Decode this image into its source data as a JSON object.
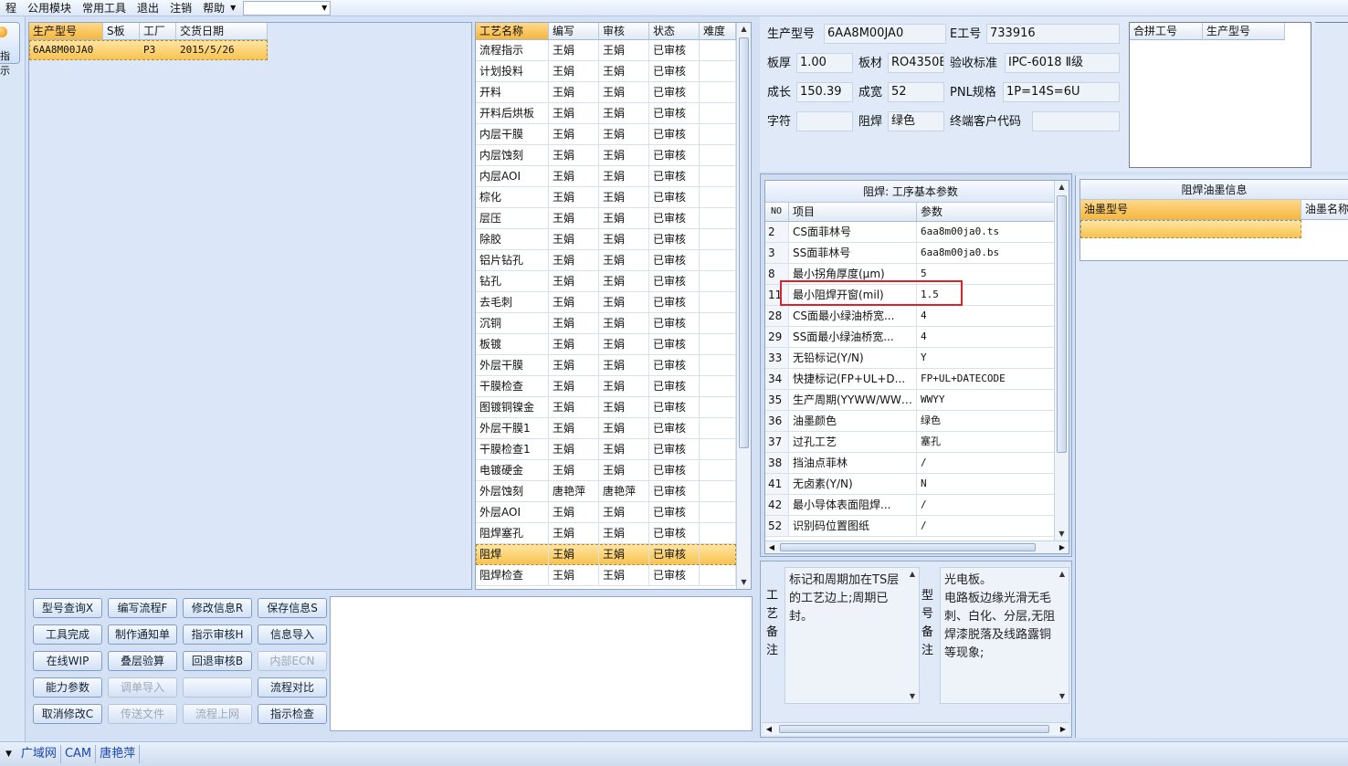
{
  "menu": {
    "items": [
      "程",
      "公用模块",
      "常用工具",
      "退出",
      "注销",
      "帮助"
    ]
  },
  "left_strip": {
    "label": "指示"
  },
  "orders": {
    "columns": [
      "生产型号",
      "S板",
      "工厂",
      "交货日期"
    ],
    "rows": [
      {
        "model": "6AA8M00JA0",
        "s": "",
        "factory": "P3",
        "date": "2015/5/26"
      }
    ]
  },
  "processes": {
    "columns": [
      "工艺名称",
      "编写",
      "审核",
      "状态",
      "难度"
    ],
    "rows": [
      [
        "流程指示",
        "王娟",
        "王娟",
        "已审核",
        ""
      ],
      [
        "计划投料",
        "王娟",
        "王娟",
        "已审核",
        ""
      ],
      [
        "开料",
        "王娟",
        "王娟",
        "已审核",
        ""
      ],
      [
        "开料后烘板",
        "王娟",
        "王娟",
        "已审核",
        ""
      ],
      [
        "内层干膜",
        "王娟",
        "王娟",
        "已审核",
        ""
      ],
      [
        "内层蚀刻",
        "王娟",
        "王娟",
        "已审核",
        ""
      ],
      [
        "内层AOI",
        "王娟",
        "王娟",
        "已审核",
        ""
      ],
      [
        "棕化",
        "王娟",
        "王娟",
        "已审核",
        ""
      ],
      [
        "层压",
        "王娟",
        "王娟",
        "已审核",
        ""
      ],
      [
        "除胶",
        "王娟",
        "王娟",
        "已审核",
        ""
      ],
      [
        "铝片钻孔",
        "王娟",
        "王娟",
        "已审核",
        ""
      ],
      [
        "钻孔",
        "王娟",
        "王娟",
        "已审核",
        ""
      ],
      [
        "去毛刺",
        "王娟",
        "王娟",
        "已审核",
        ""
      ],
      [
        "沉铜",
        "王娟",
        "王娟",
        "已审核",
        ""
      ],
      [
        "板镀",
        "王娟",
        "王娟",
        "已审核",
        ""
      ],
      [
        "外层干膜",
        "王娟",
        "王娟",
        "已审核",
        ""
      ],
      [
        "干膜检查",
        "王娟",
        "王娟",
        "已审核",
        ""
      ],
      [
        "图镀铜镍金",
        "王娟",
        "王娟",
        "已审核",
        ""
      ],
      [
        "外层干膜1",
        "王娟",
        "王娟",
        "已审核",
        ""
      ],
      [
        "干膜检查1",
        "王娟",
        "王娟",
        "已审核",
        ""
      ],
      [
        "电镀硬金",
        "王娟",
        "王娟",
        "已审核",
        ""
      ],
      [
        "外层蚀刻",
        "唐艳萍",
        "唐艳萍",
        "已审核",
        ""
      ],
      [
        "外层AOI",
        "王娟",
        "王娟",
        "已审核",
        ""
      ],
      [
        "阻焊塞孔",
        "王娟",
        "王娟",
        "已审核",
        ""
      ],
      [
        "阻焊",
        "王娟",
        "王娟",
        "已审核",
        ""
      ],
      [
        "阻焊检查",
        "王娟",
        "王娟",
        "已审核",
        ""
      ]
    ],
    "selected_index": 24
  },
  "buttons": [
    {
      "label": "型号查询X",
      "enabled": true
    },
    {
      "label": "编写流程F",
      "enabled": true
    },
    {
      "label": "修改信息R",
      "enabled": true
    },
    {
      "label": "保存信息S",
      "enabled": true
    },
    {
      "label": "工具完成",
      "enabled": true
    },
    {
      "label": "制作通知单",
      "enabled": true
    },
    {
      "label": "指示审核H",
      "enabled": true
    },
    {
      "label": "信息导入",
      "enabled": true
    },
    {
      "label": "在线WIP",
      "enabled": true
    },
    {
      "label": "叠层验算",
      "enabled": true
    },
    {
      "label": "回退审核B",
      "enabled": true
    },
    {
      "label": "内部ECN",
      "enabled": false
    },
    {
      "label": "能力参数",
      "enabled": true
    },
    {
      "label": "调单导入",
      "enabled": false
    },
    {
      "label": "",
      "enabled": false
    },
    {
      "label": "流程对比",
      "enabled": true
    },
    {
      "label": "取消修改C",
      "enabled": true
    },
    {
      "label": "传送文件",
      "enabled": false
    },
    {
      "label": "流程上网",
      "enabled": false
    },
    {
      "label": "指示检查",
      "enabled": true
    }
  ],
  "info": {
    "model_label": "生产型号",
    "model_value": "6AA8M00JA0",
    "eno_label": "E工号",
    "eno_value": "733916",
    "thick_label": "板厚",
    "thick_value": "1.00",
    "material_label": "板材",
    "material_value": "RO4350E",
    "std_label": "验收标准",
    "std_value": "IPC-6018 Ⅱ级",
    "len_label": "成长",
    "len_value": "150.39",
    "width_label": "成宽",
    "width_value": "52",
    "pnl_label": "PNL规格",
    "pnl_value": "1P=14S=6U",
    "char_label": "字符",
    "char_value": "",
    "mask_label": "阻焊",
    "mask_value": "绿色",
    "cust_label": "终端客户代码",
    "cust_value": ""
  },
  "merge": {
    "columns": [
      "合拼工号",
      "生产型号"
    ]
  },
  "params": {
    "title": "阻焊: 工序基本参数",
    "columns": [
      "NO",
      "项目",
      "参数"
    ],
    "rows": [
      [
        "2",
        "CS面菲林号",
        "6aa8m00ja0.ts"
      ],
      [
        "3",
        "SS面菲林号",
        "6aa8m00ja0.bs"
      ],
      [
        "8",
        "最小拐角厚度(μm)",
        "5"
      ],
      [
        "11",
        "最小阻焊开窗(mil)",
        "1.5"
      ],
      [
        "28",
        "CS面最小绿油桥宽...",
        "4"
      ],
      [
        "29",
        "SS面最小绿油桥宽...",
        "4"
      ],
      [
        "33",
        "无铅标记(Y/N)",
        "Y"
      ],
      [
        "34",
        "快捷标记(FP+UL+D...",
        "FP+UL+DATECODE"
      ],
      [
        "35",
        "生产周期(YYWW/WWYY)",
        "WWYY"
      ],
      [
        "36",
        "油墨颜色",
        "绿色"
      ],
      [
        "37",
        "过孔工艺",
        "塞孔"
      ],
      [
        "38",
        "挡油点菲林",
        "/"
      ],
      [
        "41",
        "无卤素(Y/N)",
        "N"
      ],
      [
        "42",
        "最小导体表面阻焊...",
        "/"
      ],
      [
        "52",
        "识别码位置图纸",
        "/"
      ]
    ],
    "highlight_index": 3,
    "highlight_color": "#d9222a"
  },
  "ink": {
    "title": "阻焊油墨信息",
    "columns": [
      "油墨型号",
      "油墨名称"
    ]
  },
  "notes": {
    "process_label": "工艺备注",
    "process_text": "标记和周期加在TS层的工艺边上;周期已封。",
    "model_label": "型号备注",
    "model_text": "光电板。\n电路板边缘光滑无毛刺、白化、分层,无阻焊漆脱落及线路露铜等现象;"
  },
  "status": [
    "广域网",
    "CAM",
    "唐艳萍"
  ]
}
